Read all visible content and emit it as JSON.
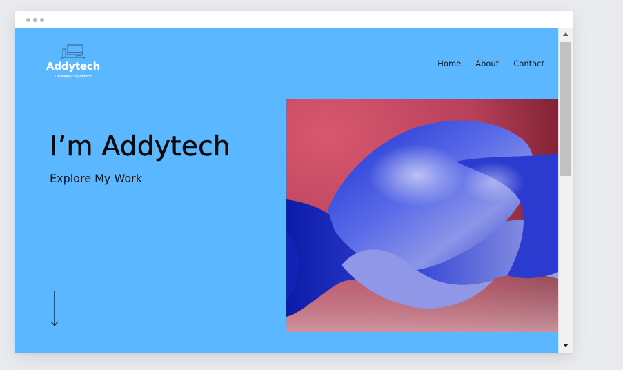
{
  "window": {
    "controls": [
      "dot",
      "dot",
      "dot"
    ]
  },
  "brand": {
    "icon": "computer-desk-icon",
    "name": "Addytech",
    "tagline": "Developer by choice"
  },
  "nav": {
    "home": "Home",
    "about": "About",
    "contact": "Contact"
  },
  "hero": {
    "title": "I’m Addytech",
    "subtitle": "Explore My Work",
    "scroll_icon": "arrow-down-icon",
    "image_alt": "abstract blue 3D shape on red gradient"
  },
  "colors": {
    "page_background": "#5bb7ff",
    "text": "#0a0a0a",
    "logo": "#ffffff"
  },
  "scrollbar": {
    "icons": [
      "scroll-up-icon",
      "scroll-down-icon"
    ]
  }
}
